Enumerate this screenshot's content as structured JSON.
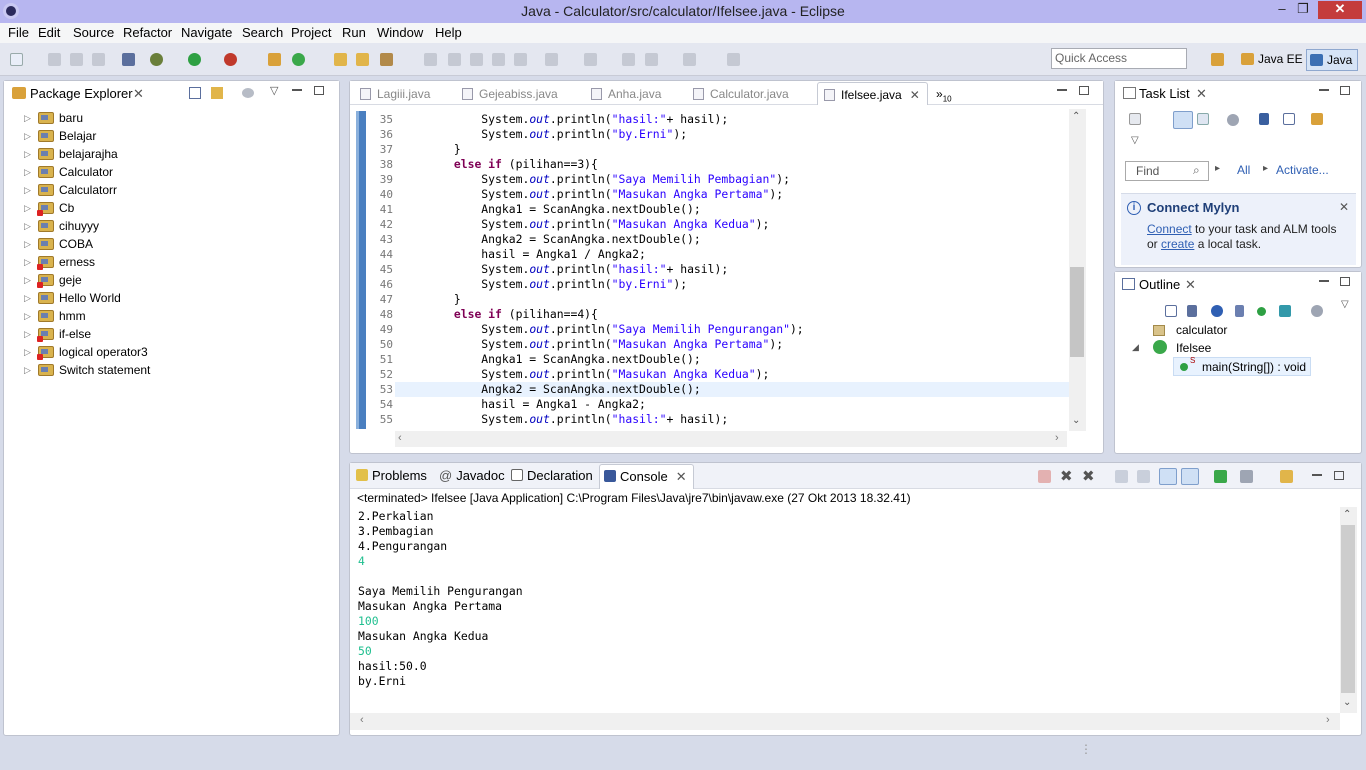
{
  "window": {
    "title": "Java - Calculator/src/calculator/Ifelsee.java - Eclipse",
    "minimize": "–",
    "restore": "❐",
    "close": "✕"
  },
  "menu": [
    "File",
    "Edit",
    "Source",
    "Refactor",
    "Navigate",
    "Search",
    "Project",
    "Run",
    "Window",
    "Help"
  ],
  "toolbar": {
    "quick_access_placeholder": "Quick Access",
    "perspectives": [
      "Java EE",
      "Java"
    ]
  },
  "package_explorer": {
    "title": "Package Explorer",
    "projects": [
      {
        "name": "baru",
        "error": false
      },
      {
        "name": "Belajar",
        "error": false
      },
      {
        "name": "belajarajha",
        "error": false
      },
      {
        "name": "Calculator",
        "error": false
      },
      {
        "name": "Calculatorr",
        "error": false
      },
      {
        "name": "Cb",
        "error": true
      },
      {
        "name": "cihuyyy",
        "error": false
      },
      {
        "name": "COBA",
        "error": false
      },
      {
        "name": "erness",
        "error": true
      },
      {
        "name": "geje",
        "error": true
      },
      {
        "name": "Hello World",
        "error": false
      },
      {
        "name": "hmm",
        "error": false
      },
      {
        "name": "if-else",
        "error": true
      },
      {
        "name": "logical operator3",
        "error": true
      },
      {
        "name": "Switch statement",
        "error": false
      }
    ]
  },
  "editor": {
    "tabs": [
      "Lagiii.java",
      "Gejeabiss.java",
      "Anha.java",
      "Calculator.java",
      "Ifelsee.java"
    ],
    "active_tab": "Ifelsee.java",
    "overflow_count": "10",
    "highlighted_line": 53,
    "lines": [
      {
        "n": 35,
        "html": "            System.<span class=\"fld\">out</span>.println(<span class=\"str\">\"hasil:\"</span>+ hasil);"
      },
      {
        "n": 36,
        "html": "            System.<span class=\"fld\">out</span>.println(<span class=\"str\">\"by.Erni\"</span>);"
      },
      {
        "n": 37,
        "html": "        }"
      },
      {
        "n": 38,
        "html": "        <span class=\"kw\">else if</span> (pilihan==3){"
      },
      {
        "n": 39,
        "html": "            System.<span class=\"fld\">out</span>.println(<span class=\"str\">\"Saya Memilih Pembagian\"</span>);"
      },
      {
        "n": 40,
        "html": "            System.<span class=\"fld\">out</span>.println(<span class=\"str\">\"Masukan Angka Pertama\"</span>);"
      },
      {
        "n": 41,
        "html": "            Angka1 = ScanAngka.nextDouble();"
      },
      {
        "n": 42,
        "html": "            System.<span class=\"fld\">out</span>.println(<span class=\"str\">\"Masukan Angka Kedua\"</span>);"
      },
      {
        "n": 43,
        "html": "            Angka2 = ScanAngka.nextDouble();"
      },
      {
        "n": 44,
        "html": "            hasil = Angka1 / Angka2;"
      },
      {
        "n": 45,
        "html": "            System.<span class=\"fld\">out</span>.println(<span class=\"str\">\"hasil:\"</span>+ hasil);"
      },
      {
        "n": 46,
        "html": "            System.<span class=\"fld\">out</span>.println(<span class=\"str\">\"by.Erni\"</span>);"
      },
      {
        "n": 47,
        "html": "        }"
      },
      {
        "n": 48,
        "html": "        <span class=\"kw\">else if</span> (pilihan==4){"
      },
      {
        "n": 49,
        "html": "            System.<span class=\"fld\">out</span>.println(<span class=\"str\">\"Saya Memilih Pengurangan\"</span>);"
      },
      {
        "n": 50,
        "html": "            System.<span class=\"fld\">out</span>.println(<span class=\"str\">\"Masukan Angka Pertama\"</span>);"
      },
      {
        "n": 51,
        "html": "            Angka1 = ScanAngka.nextDouble();"
      },
      {
        "n": 52,
        "html": "            System.<span class=\"fld\">out</span>.println(<span class=\"str\">\"Masukan Angka Kedua\"</span>);"
      },
      {
        "n": 53,
        "html": "            Angka2 = ScanAngka.nextDouble();"
      },
      {
        "n": 54,
        "html": "            hasil = Angka1 - Angka2;"
      },
      {
        "n": 55,
        "html": "            System.<span class=\"fld\">out</span>.println(<span class=\"str\">\"hasil:\"</span>+ hasil);"
      }
    ]
  },
  "task_list": {
    "title": "Task List",
    "find_placeholder": "Find",
    "all_label": "All",
    "activate_label": "Activate..."
  },
  "mylyn": {
    "title": "Connect Mylyn",
    "connect_link": "Connect",
    "text1": " to your task and ALM tools",
    "text2_prefix": "or ",
    "create_link": "create",
    "text2_suffix": " a local task."
  },
  "outline": {
    "title": "Outline",
    "package": "calculator",
    "class": "Ifelsee",
    "method": "main(String[]) : void",
    "method_modifier": "S"
  },
  "bottom": {
    "tabs": [
      "Problems",
      "Javadoc",
      "Declaration",
      "Console"
    ],
    "active_tab": "Console",
    "console_header": "<terminated> Ifelsee [Java Application] C:\\Program Files\\Java\\jre7\\bin\\javaw.exe (27 Okt 2013 18.32.41)",
    "console_lines": [
      {
        "text": "2.Perkalian",
        "input": false
      },
      {
        "text": "3.Pembagian",
        "input": false
      },
      {
        "text": "4.Pengurangan",
        "input": false
      },
      {
        "text": "4",
        "input": true
      },
      {
        "text": "",
        "input": false
      },
      {
        "text": "Saya Memilih Pengurangan",
        "input": false
      },
      {
        "text": "Masukan Angka Pertama",
        "input": false
      },
      {
        "text": "100",
        "input": true
      },
      {
        "text": "Masukan Angka Kedua",
        "input": false
      },
      {
        "text": "50",
        "input": true
      },
      {
        "text": "hasil:50.0",
        "input": false
      },
      {
        "text": "by.Erni",
        "input": false
      }
    ]
  },
  "colors": {
    "keyword": "#7f0055",
    "string": "#2a00ff",
    "field": "#0000c0",
    "console_input": "#1fbf8f",
    "titlebar": "#b7b6f0",
    "close_button": "#c43c3c"
  }
}
